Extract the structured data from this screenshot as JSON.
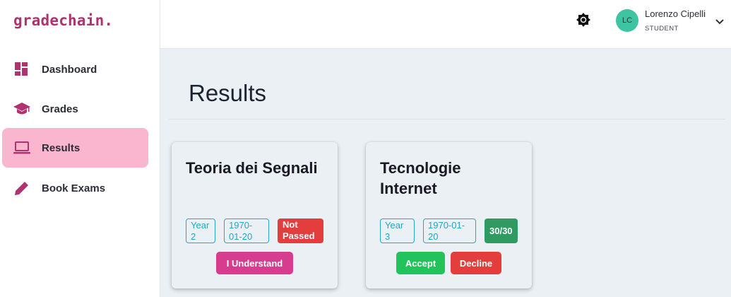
{
  "app": {
    "logo": "gradechain."
  },
  "sidebar": {
    "items": [
      {
        "label": "Dashboard",
        "icon": "dashboard-icon",
        "active": false
      },
      {
        "label": "Grades",
        "icon": "graduation-cap-icon",
        "active": false
      },
      {
        "label": "Results",
        "icon": "laptop-icon",
        "active": true
      },
      {
        "label": "Book Exams",
        "icon": "pencil-icon",
        "active": false
      }
    ]
  },
  "header": {
    "theme_icon": "brightness-icon",
    "user": {
      "initials": "LC",
      "name": "Lorenzo Cipelli",
      "role": "STUDENT"
    }
  },
  "main": {
    "title": "Results",
    "cards": [
      {
        "title": "Teoria dei Segnali",
        "year": "Year 2",
        "date": "1970-01-20",
        "status": "Not Passed",
        "actions": [
          "I Understand"
        ]
      },
      {
        "title": "Tecnologie Internet",
        "year": "Year 3",
        "date": "1970-01-20",
        "grade": "30/30",
        "actions": [
          "Accept",
          "Decline"
        ]
      }
    ]
  },
  "colors": {
    "brand": "#b0336f",
    "active_nav": "#fbb6cf",
    "tag": "#22a6c9",
    "danger": "#e33d3d",
    "success": "#22c35c",
    "grade_badge": "#2f9b62",
    "understand": "#d63d8e",
    "avatar": "#3cc5a0"
  }
}
